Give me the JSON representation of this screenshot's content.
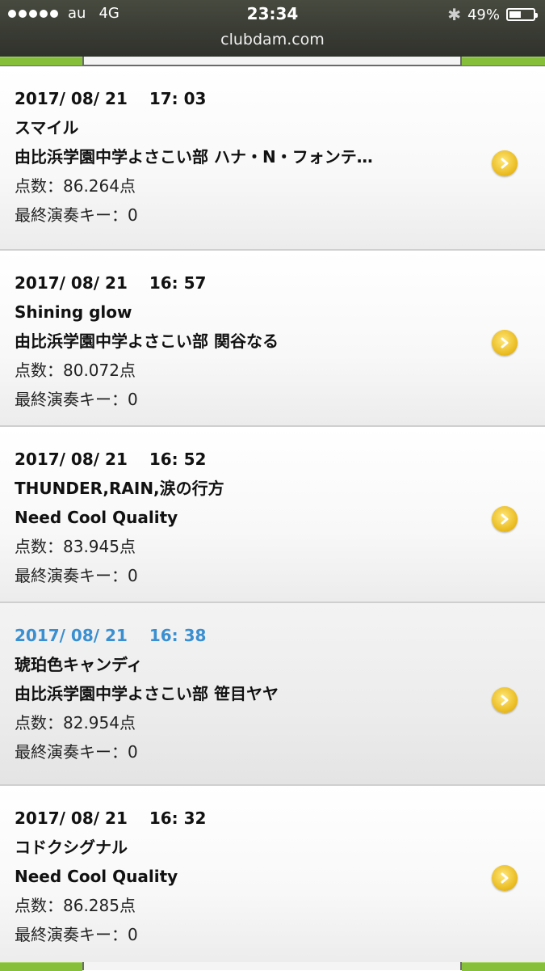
{
  "status": {
    "carrier": "au",
    "network": "4G",
    "time": "23:34",
    "battery": "49%",
    "battery_level": 0.49,
    "url": "clubdam.com"
  },
  "entries": [
    {
      "datetime": "2017/ 08/ 21　 17: 03",
      "title": "スマイル",
      "artist": "由比浜学園中学よさこい部 ハナ・N・フォンテ…",
      "score": "点数：86.264点",
      "key": "最終演奏キー：0"
    },
    {
      "datetime": "2017/ 08/ 21　 16: 57",
      "title": "Shining glow",
      "artist": "由比浜学園中学よさこい部 関谷なる",
      "score": "点数：80.072点",
      "key": "最終演奏キー：0"
    },
    {
      "datetime": "2017/ 08/ 21　 16: 52",
      "title": "THUNDER,RAIN,涙の行方",
      "artist": "Need Cool Quality",
      "score": "点数：83.945点",
      "key": "最終演奏キー：0"
    },
    {
      "datetime": "2017/ 08/ 21　 16: 38",
      "title": "琥珀色キャンディ",
      "artist": "由比浜学園中学よさこい部 笹目ヤヤ",
      "score": "点数：82.954点",
      "key": "最終演奏キー：0"
    },
    {
      "datetime": "2017/ 08/ 21　 16: 32",
      "title": "コドクシグナル",
      "artist": "Need Cool Quality",
      "score": "点数：86.285点",
      "key": "最終演奏キー：0"
    }
  ],
  "colors": {
    "tab_green": "#86c03a",
    "highlight_date": "#3a8fd0",
    "arrow": "#e8b81a"
  },
  "icons": {
    "row_arrow": "chevron-right-circle-icon",
    "bluetooth": "bluetooth-icon",
    "battery": "battery-icon"
  }
}
